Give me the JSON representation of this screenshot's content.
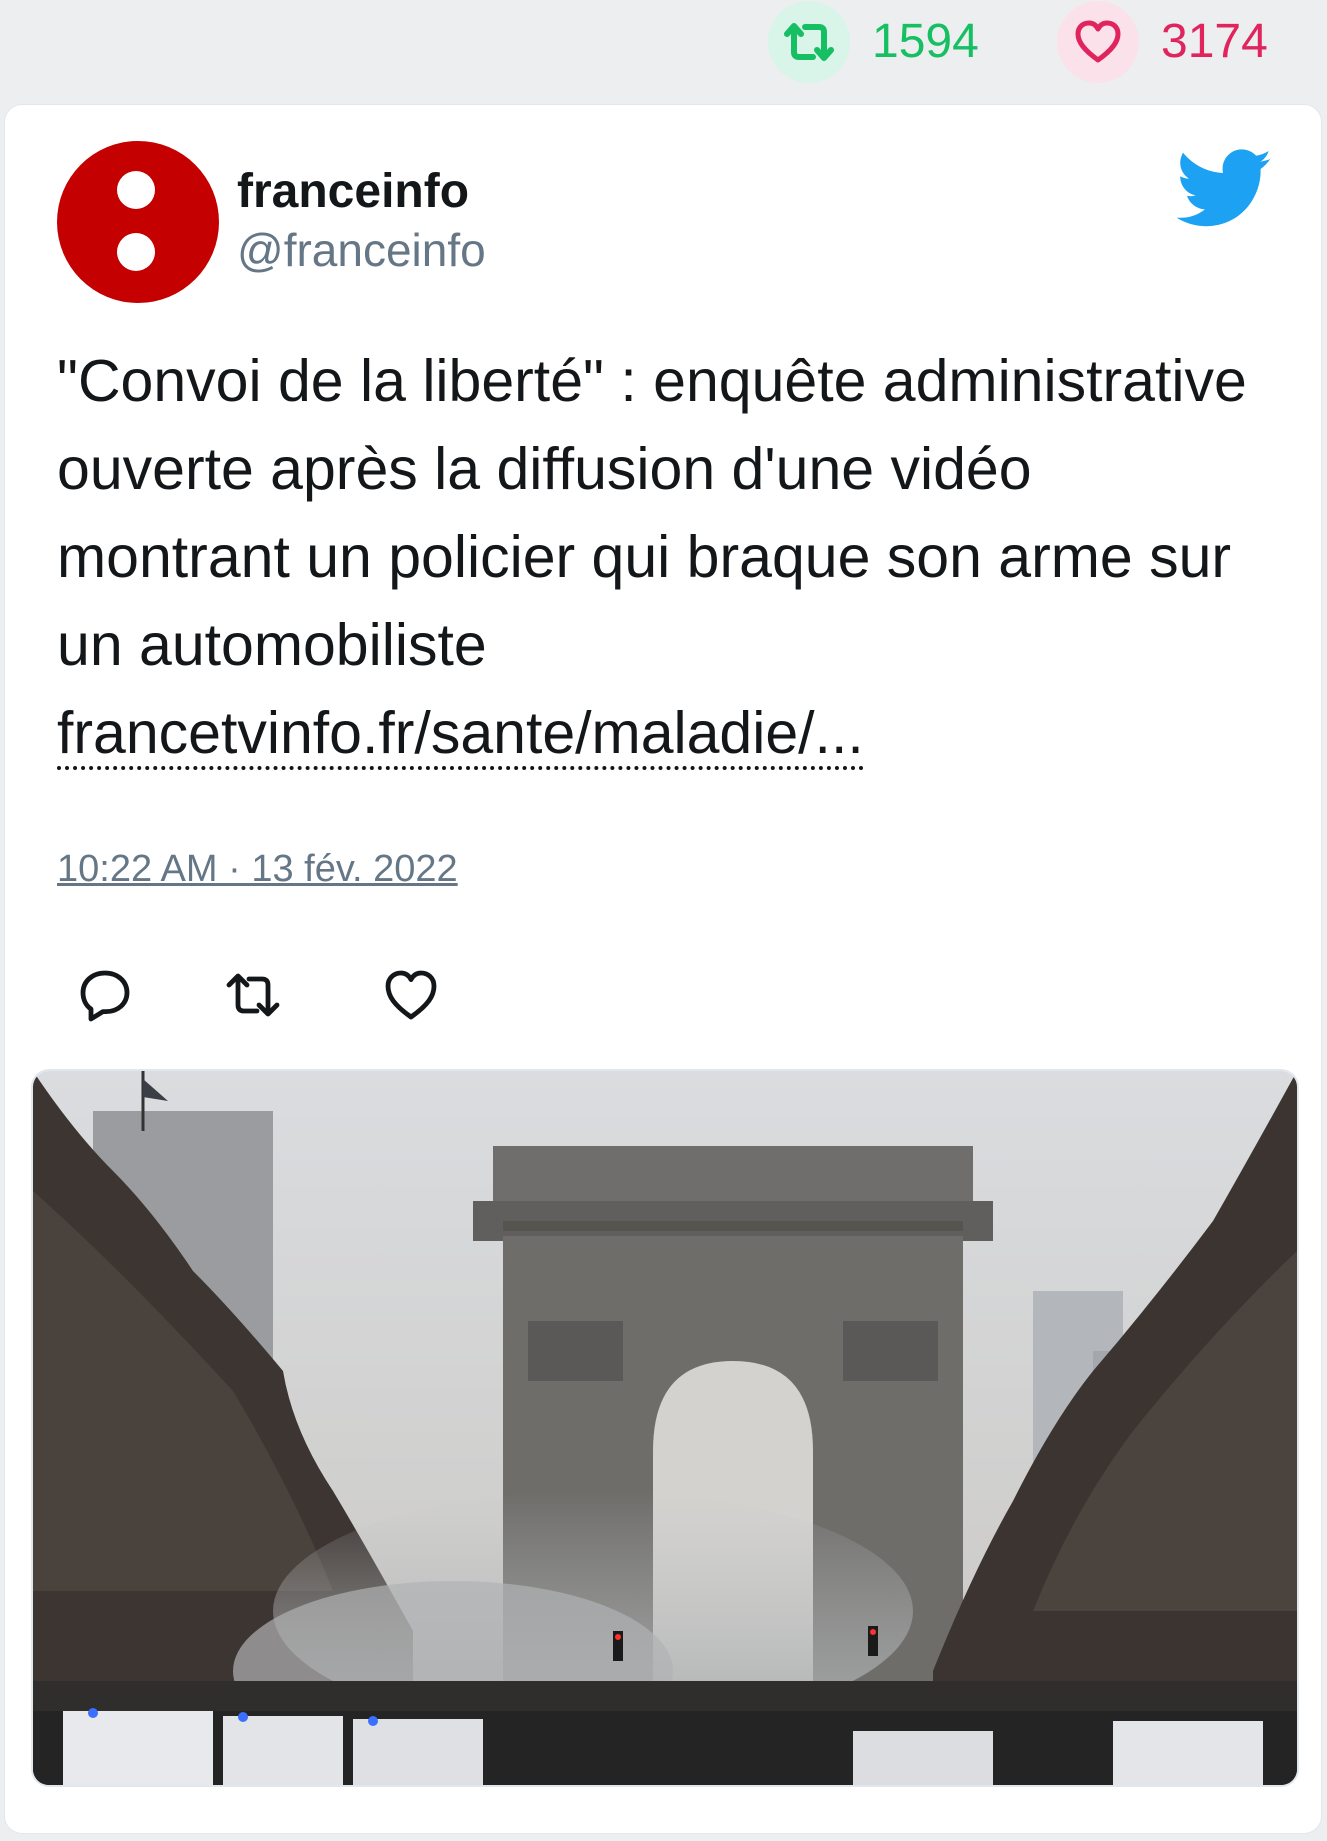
{
  "stats": {
    "retweets": "1594",
    "likes": "3174",
    "retweet_icon": "retweet-icon",
    "like_icon": "heart-icon",
    "retweet_color": "#17bf63",
    "like_color": "#e0245e"
  },
  "tweet": {
    "display_name": "franceinfo",
    "handle": "@franceinfo",
    "text": "\"Convoi de la liberté\" : enquête administrative ouverte après la diffusion d'une vidéo montrant un policier qui braque son arme sur un automobiliste",
    "link": "francetvinfo.fr/sante/maladie/...",
    "timestamp": "10:22 AM · 13 fév. 2022",
    "avatar_color": "#c40000",
    "brand_icon": "twitter-bird-icon",
    "brand_color": "#1da1f2"
  },
  "actions": [
    {
      "name": "reply",
      "icon": "reply-icon"
    },
    {
      "name": "retweet",
      "icon": "retweet-icon"
    },
    {
      "name": "like",
      "icon": "heart-icon"
    }
  ],
  "media": {
    "type": "photo"
  }
}
